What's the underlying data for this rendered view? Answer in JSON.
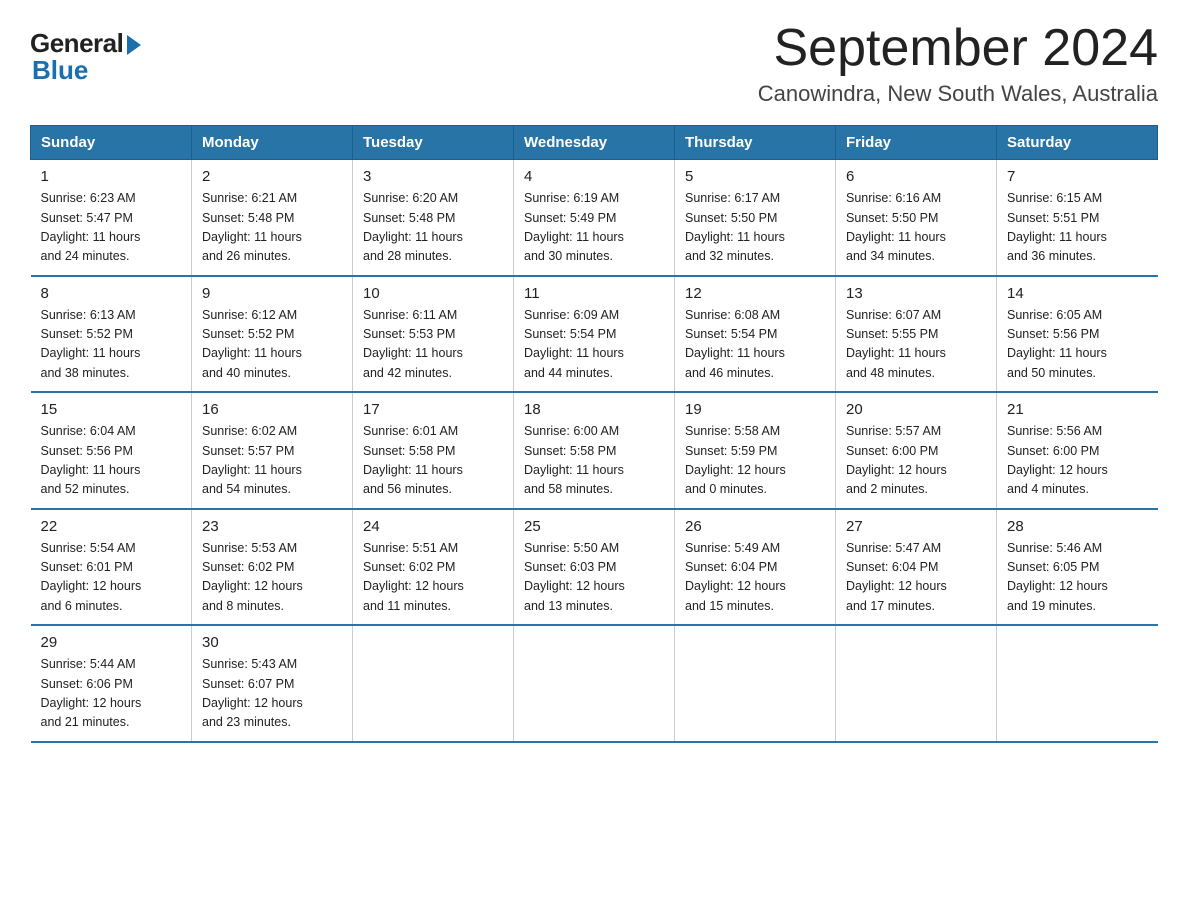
{
  "logo": {
    "general": "General",
    "blue": "Blue"
  },
  "title": "September 2024",
  "subtitle": "Canowindra, New South Wales, Australia",
  "days_of_week": [
    "Sunday",
    "Monday",
    "Tuesday",
    "Wednesday",
    "Thursday",
    "Friday",
    "Saturday"
  ],
  "weeks": [
    [
      {
        "day": "1",
        "sunrise": "6:23 AM",
        "sunset": "5:47 PM",
        "daylight": "11 hours and 24 minutes."
      },
      {
        "day": "2",
        "sunrise": "6:21 AM",
        "sunset": "5:48 PM",
        "daylight": "11 hours and 26 minutes."
      },
      {
        "day": "3",
        "sunrise": "6:20 AM",
        "sunset": "5:48 PM",
        "daylight": "11 hours and 28 minutes."
      },
      {
        "day": "4",
        "sunrise": "6:19 AM",
        "sunset": "5:49 PM",
        "daylight": "11 hours and 30 minutes."
      },
      {
        "day": "5",
        "sunrise": "6:17 AM",
        "sunset": "5:50 PM",
        "daylight": "11 hours and 32 minutes."
      },
      {
        "day": "6",
        "sunrise": "6:16 AM",
        "sunset": "5:50 PM",
        "daylight": "11 hours and 34 minutes."
      },
      {
        "day": "7",
        "sunrise": "6:15 AM",
        "sunset": "5:51 PM",
        "daylight": "11 hours and 36 minutes."
      }
    ],
    [
      {
        "day": "8",
        "sunrise": "6:13 AM",
        "sunset": "5:52 PM",
        "daylight": "11 hours and 38 minutes."
      },
      {
        "day": "9",
        "sunrise": "6:12 AM",
        "sunset": "5:52 PM",
        "daylight": "11 hours and 40 minutes."
      },
      {
        "day": "10",
        "sunrise": "6:11 AM",
        "sunset": "5:53 PM",
        "daylight": "11 hours and 42 minutes."
      },
      {
        "day": "11",
        "sunrise": "6:09 AM",
        "sunset": "5:54 PM",
        "daylight": "11 hours and 44 minutes."
      },
      {
        "day": "12",
        "sunrise": "6:08 AM",
        "sunset": "5:54 PM",
        "daylight": "11 hours and 46 minutes."
      },
      {
        "day": "13",
        "sunrise": "6:07 AM",
        "sunset": "5:55 PM",
        "daylight": "11 hours and 48 minutes."
      },
      {
        "day": "14",
        "sunrise": "6:05 AM",
        "sunset": "5:56 PM",
        "daylight": "11 hours and 50 minutes."
      }
    ],
    [
      {
        "day": "15",
        "sunrise": "6:04 AM",
        "sunset": "5:56 PM",
        "daylight": "11 hours and 52 minutes."
      },
      {
        "day": "16",
        "sunrise": "6:02 AM",
        "sunset": "5:57 PM",
        "daylight": "11 hours and 54 minutes."
      },
      {
        "day": "17",
        "sunrise": "6:01 AM",
        "sunset": "5:58 PM",
        "daylight": "11 hours and 56 minutes."
      },
      {
        "day": "18",
        "sunrise": "6:00 AM",
        "sunset": "5:58 PM",
        "daylight": "11 hours and 58 minutes."
      },
      {
        "day": "19",
        "sunrise": "5:58 AM",
        "sunset": "5:59 PM",
        "daylight": "12 hours and 0 minutes."
      },
      {
        "day": "20",
        "sunrise": "5:57 AM",
        "sunset": "6:00 PM",
        "daylight": "12 hours and 2 minutes."
      },
      {
        "day": "21",
        "sunrise": "5:56 AM",
        "sunset": "6:00 PM",
        "daylight": "12 hours and 4 minutes."
      }
    ],
    [
      {
        "day": "22",
        "sunrise": "5:54 AM",
        "sunset": "6:01 PM",
        "daylight": "12 hours and 6 minutes."
      },
      {
        "day": "23",
        "sunrise": "5:53 AM",
        "sunset": "6:02 PM",
        "daylight": "12 hours and 8 minutes."
      },
      {
        "day": "24",
        "sunrise": "5:51 AM",
        "sunset": "6:02 PM",
        "daylight": "12 hours and 11 minutes."
      },
      {
        "day": "25",
        "sunrise": "5:50 AM",
        "sunset": "6:03 PM",
        "daylight": "12 hours and 13 minutes."
      },
      {
        "day": "26",
        "sunrise": "5:49 AM",
        "sunset": "6:04 PM",
        "daylight": "12 hours and 15 minutes."
      },
      {
        "day": "27",
        "sunrise": "5:47 AM",
        "sunset": "6:04 PM",
        "daylight": "12 hours and 17 minutes."
      },
      {
        "day": "28",
        "sunrise": "5:46 AM",
        "sunset": "6:05 PM",
        "daylight": "12 hours and 19 minutes."
      }
    ],
    [
      {
        "day": "29",
        "sunrise": "5:44 AM",
        "sunset": "6:06 PM",
        "daylight": "12 hours and 21 minutes."
      },
      {
        "day": "30",
        "sunrise": "5:43 AM",
        "sunset": "6:07 PM",
        "daylight": "12 hours and 23 minutes."
      },
      null,
      null,
      null,
      null,
      null
    ]
  ]
}
